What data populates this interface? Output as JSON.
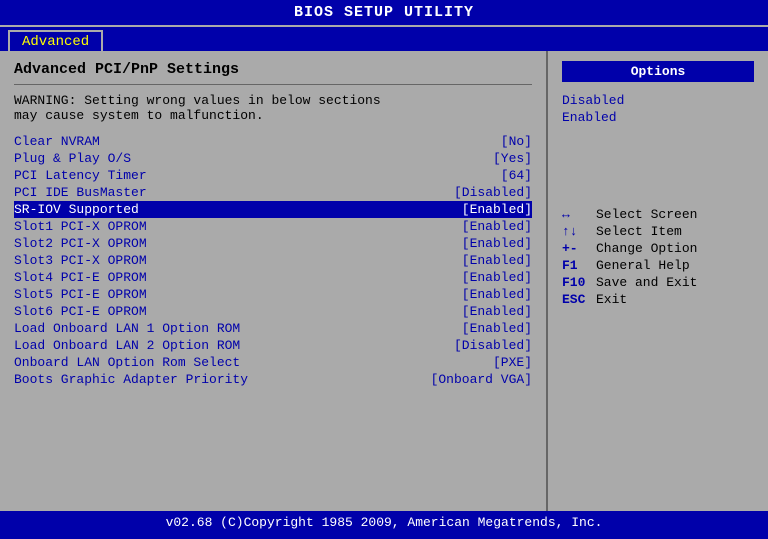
{
  "header": {
    "title": "BIOS SETUP UTILITY"
  },
  "tabs": [
    {
      "label": "Advanced",
      "active": true
    }
  ],
  "left_panel": {
    "title": "Advanced PCI/PnP Settings",
    "warning_line1": "WARNING: Setting wrong values in below sections",
    "warning_line2": "        may cause system to malfunction.",
    "settings": [
      {
        "name": "Clear NVRAM",
        "value": "[No]",
        "highlighted": false
      },
      {
        "name": "Plug & Play O/S",
        "value": "[Yes]",
        "highlighted": false
      },
      {
        "name": "PCI Latency Timer",
        "value": "[64]",
        "highlighted": false
      },
      {
        "name": "PCI IDE BusMaster",
        "value": "[Disabled]",
        "highlighted": false
      },
      {
        "name": "SR-IOV Supported",
        "value": "[Enabled]",
        "highlighted": true
      },
      {
        "name": "Slot1 PCI-X OPROM",
        "value": "[Enabled]",
        "highlighted": false
      },
      {
        "name": "Slot2 PCI-X OPROM",
        "value": "[Enabled]",
        "highlighted": false
      },
      {
        "name": "Slot3 PCI-X OPROM",
        "value": "[Enabled]",
        "highlighted": false
      },
      {
        "name": "Slot4 PCI-E OPROM",
        "value": "[Enabled]",
        "highlighted": false
      },
      {
        "name": "Slot5 PCI-E OPROM",
        "value": "[Enabled]",
        "highlighted": false
      },
      {
        "name": "Slot6 PCI-E OPROM",
        "value": "[Enabled]",
        "highlighted": false
      },
      {
        "name": "Load Onboard LAN 1 Option ROM",
        "value": "[Enabled]",
        "highlighted": false
      },
      {
        "name": "Load Onboard LAN 2 Option ROM",
        "value": "[Disabled]",
        "highlighted": false
      },
      {
        "name": "Onboard LAN Option Rom Select",
        "value": "[PXE]",
        "highlighted": false
      },
      {
        "name": "Boots Graphic Adapter Priority",
        "value": "[Onboard VGA]",
        "highlighted": false
      }
    ]
  },
  "right_panel": {
    "options_header": "Options",
    "options": [
      {
        "label": "Disabled"
      },
      {
        "label": "Enabled"
      }
    ],
    "key_help": [
      {
        "key": "↔",
        "desc": "Select Screen"
      },
      {
        "key": "↑↓",
        "desc": "Select Item"
      },
      {
        "key": "+-",
        "desc": "Change Option"
      },
      {
        "key": "F1",
        "desc": "General Help"
      },
      {
        "key": "F10",
        "desc": "Save and Exit"
      },
      {
        "key": "ESC",
        "desc": "Exit"
      }
    ]
  },
  "footer": {
    "text": "v02.68  (C)Copyright 1985 2009, American Megatrends, Inc."
  }
}
